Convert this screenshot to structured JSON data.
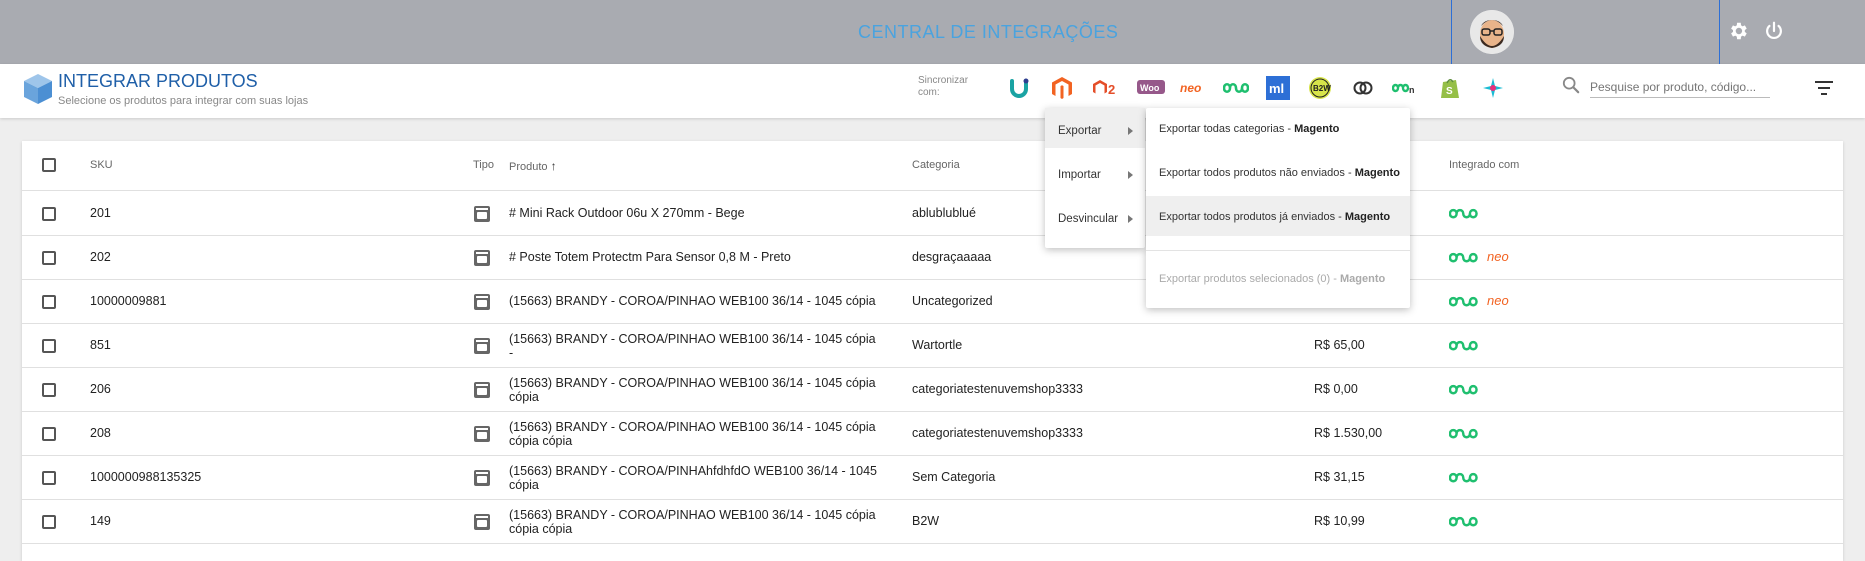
{
  "topbar": {
    "title": "CENTRAL DE INTEGRAÇÕES"
  },
  "header": {
    "title": "INTEGRAR PRODUTOS",
    "subtitle": "Selecione os produtos para integrar com suas lojas",
    "sync_label": "Sincronizar com:",
    "search_placeholder": "Pesquise por produto, código...",
    "integrations": [
      {
        "name": "U",
        "color": "#1aa3a3"
      },
      {
        "name": "Magento",
        "color": "#f26322"
      },
      {
        "name": "M2",
        "color": "#e44e29"
      },
      {
        "name": "Woo",
        "color": "#96588a"
      },
      {
        "name": "neo",
        "color": "#f26322"
      },
      {
        "name": "Integrator",
        "color": "#1fbf6f"
      },
      {
        "name": "ml",
        "color": "#2d6fd6"
      },
      {
        "name": "B2W",
        "color": "#d7e44a"
      },
      {
        "name": "Link",
        "color": "#333333"
      },
      {
        "name": "Connect",
        "color": "#1fbf6f"
      },
      {
        "name": "Shopify",
        "color": "#95bf47"
      },
      {
        "name": "Tray",
        "color": "#1abcd4"
      }
    ]
  },
  "table": {
    "columns": {
      "sku": "SKU",
      "tipo": "Tipo",
      "produto": "Produto",
      "categoria": "Categoria",
      "integrado": "Integrado com"
    },
    "rows": [
      {
        "sku": "201",
        "produto": "# Mini Rack Outdoor 06u X 270mm - Bege",
        "produto2": "",
        "categoria": "ablublublué",
        "preco": "",
        "neo": false
      },
      {
        "sku": "202",
        "produto": "# Poste Totem Protectm Para Sensor 0,8 M - Preto",
        "produto2": "",
        "categoria": "desgraçaaaaa",
        "preco": "",
        "neo": true
      },
      {
        "sku": "10000009881",
        "produto": "(15663) BRANDY - COROA/PINHAO WEB100 36/14 - 1045 cópia",
        "produto2": "",
        "categoria": "Uncategorized",
        "preco": "",
        "neo": true
      },
      {
        "sku": "851",
        "produto": "(15663) BRANDY - COROA/PINHAO WEB100 36/14 - 1045 cópia",
        "produto2": "-",
        "categoria": "Wartortle",
        "preco": "R$ 65,00",
        "neo": false
      },
      {
        "sku": "206",
        "produto": "(15663) BRANDY - COROA/PINHAO WEB100 36/14 - 1045 cópia",
        "produto2": "cópia",
        "categoria": "categoriatestenuvemshop3333",
        "preco": "R$ 0,00",
        "neo": false
      },
      {
        "sku": "208",
        "produto": "(15663) BRANDY - COROA/PINHAO WEB100 36/14 - 1045 cópia",
        "produto2": "cópia cópia",
        "categoria": "categoriatestenuvemshop3333",
        "preco": "R$ 1.530,00",
        "neo": false
      },
      {
        "sku": "1000000988135325",
        "produto": "(15663) BRANDY - COROA/PINHAhfdhfdO WEB100 36/14 - 1045",
        "produto2": "cópia",
        "categoria": "Sem Categoria",
        "preco": "R$ 31,15",
        "neo": false
      },
      {
        "sku": "149",
        "produto": "(15663) BRANDY - COROA/PINHAO WEB100 36/14 - 1045 cópia",
        "produto2": "cópia cópia",
        "categoria": "B2W",
        "preco": "R$ 10,99",
        "neo": false
      }
    ],
    "neo_label": "neo"
  },
  "menu": {
    "items": [
      {
        "label": "Exportar"
      },
      {
        "label": "Importar"
      },
      {
        "label": "Desvincular"
      }
    ],
    "submenu": [
      {
        "text": "Exportar todas categorias - ",
        "bold": "Magento"
      },
      {
        "text": "Exportar todos produtos não enviados - ",
        "bold": "Magento"
      },
      {
        "text": "Exportar todos produtos já enviados - ",
        "bold": "Magento"
      },
      {
        "text": "Exportar produtos selecionados (0) - ",
        "bold": "Magento"
      }
    ]
  }
}
